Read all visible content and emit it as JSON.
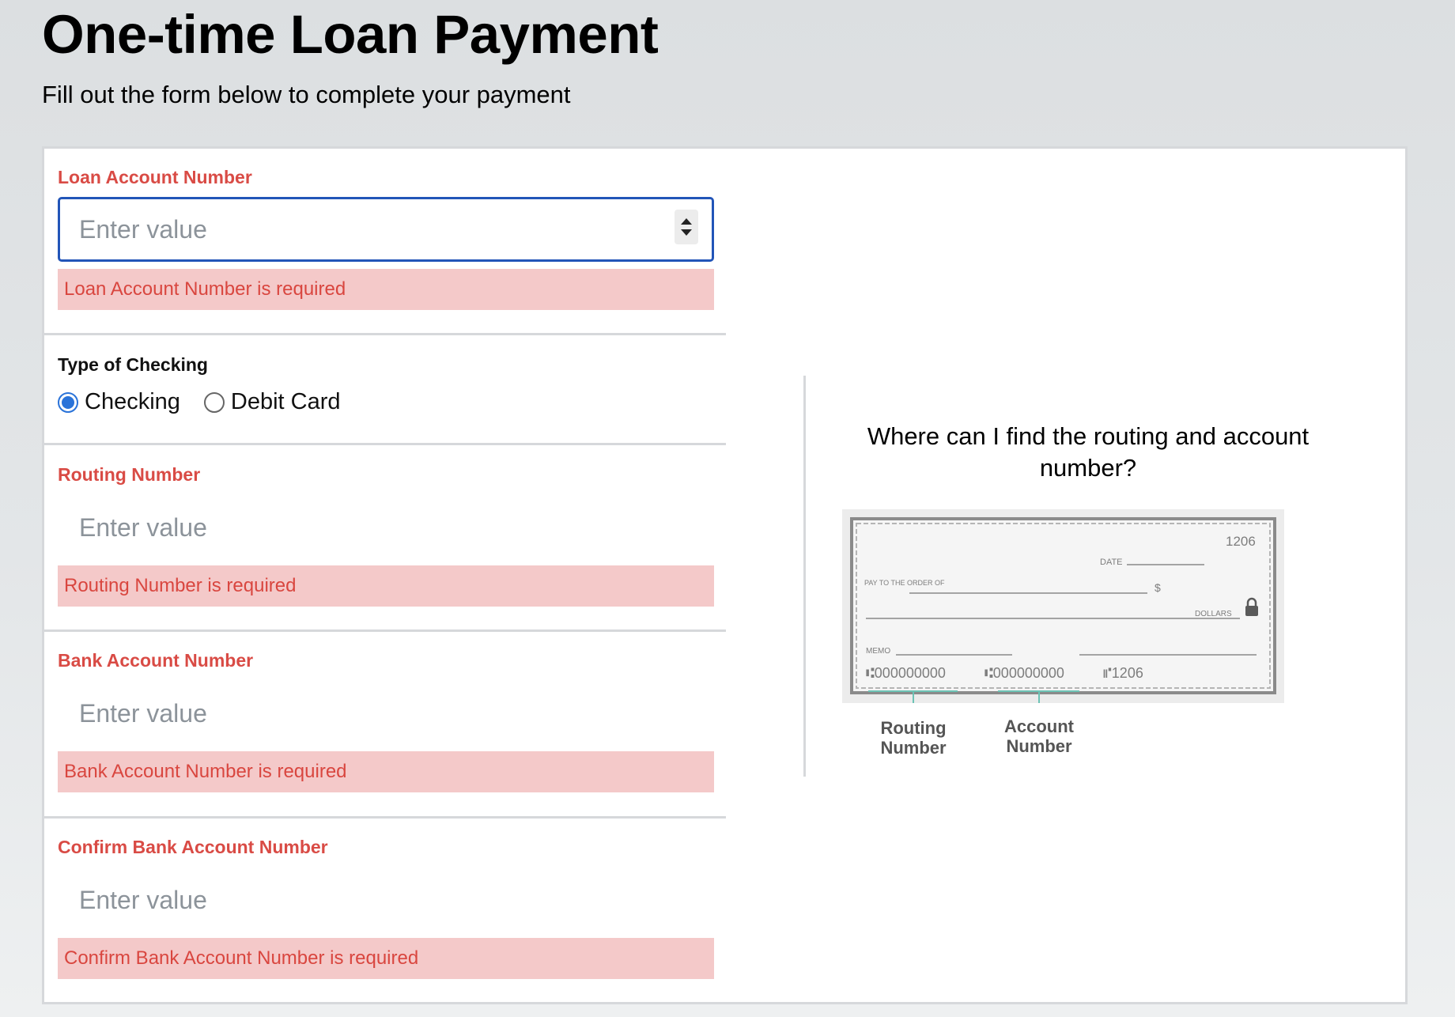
{
  "page": {
    "title": "One-time Loan Payment",
    "subtitle": "Fill out the form below to complete your payment"
  },
  "form": {
    "loan_account": {
      "label": "Loan Account Number",
      "placeholder": "Enter value",
      "value": "",
      "error": "Loan Account Number is required"
    },
    "checking_type": {
      "label": "Type of Checking",
      "options": [
        "Checking",
        "Debit Card"
      ],
      "selected": "Checking"
    },
    "routing": {
      "label": "Routing Number",
      "placeholder": "Enter value",
      "value": "",
      "error": "Routing Number is required"
    },
    "bank_account": {
      "label": "Bank Account Number",
      "placeholder": "Enter value",
      "value": "",
      "error": "Bank Account Number is required"
    },
    "confirm_bank_account": {
      "label": "Confirm Bank Account Number",
      "placeholder": "Enter value",
      "value": "",
      "error": "Confirm Bank Account Number is required"
    }
  },
  "help": {
    "question": "Where can I find the routing and account number?",
    "check": {
      "number": "1206",
      "date_label": "DATE",
      "pay_to_label": "PAY TO THE ORDER OF",
      "currency_symbol": "$",
      "dollars_label": "DOLLARS",
      "memo_label": "MEMO",
      "routing_digits": "⑆000000000",
      "account_digits": "⑆000000000",
      "check_digits": "⑈1206"
    },
    "routing_caption": "Routing Number",
    "account_caption": "Account Number"
  },
  "colors": {
    "error_text": "#d94b45",
    "error_bg": "#f4c9c9",
    "focus_border": "#2255b8",
    "radio_accent": "#2a73d9"
  }
}
